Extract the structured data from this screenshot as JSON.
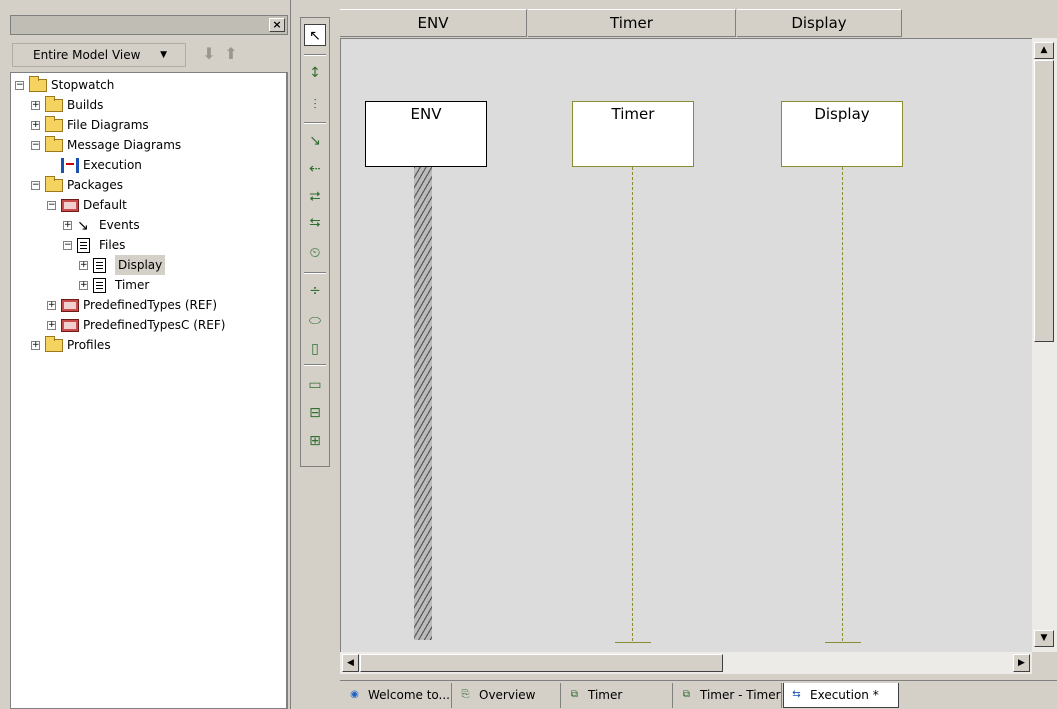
{
  "browser": {
    "view_label": "Entire Model View",
    "tree": [
      {
        "label": "Stopwatch",
        "icon": "project-folder-icon",
        "depth": 0,
        "expander": "−"
      },
      {
        "label": "Builds",
        "icon": "folder-icon",
        "depth": 1,
        "expander": "+"
      },
      {
        "label": "File Diagrams",
        "icon": "folder-icon",
        "depth": 1,
        "expander": "+"
      },
      {
        "label": "Message Diagrams",
        "icon": "folder-icon",
        "depth": 1,
        "expander": "−"
      },
      {
        "label": "Execution",
        "icon": "sequence-diagram-icon",
        "depth": 2,
        "expander": ""
      },
      {
        "label": "Packages",
        "icon": "folder-icon",
        "depth": 1,
        "expander": "−"
      },
      {
        "label": "Default",
        "icon": "package-icon",
        "depth": 2,
        "expander": "−"
      },
      {
        "label": "Events",
        "icon": "event-icon",
        "depth": 3,
        "expander": "+"
      },
      {
        "label": "Files",
        "icon": "files-icon",
        "depth": 3,
        "expander": "−"
      },
      {
        "label": "Display",
        "icon": "file-icon",
        "depth": 4,
        "expander": "+",
        "selected": true
      },
      {
        "label": "Timer",
        "icon": "file-icon",
        "depth": 4,
        "expander": "+"
      },
      {
        "label": "PredefinedTypes (REF)",
        "icon": "package-icon",
        "depth": 2,
        "expander": "+"
      },
      {
        "label": "PredefinedTypesC (REF)",
        "icon": "package-icon",
        "depth": 2,
        "expander": "+"
      },
      {
        "label": "Profiles",
        "icon": "folder-icon",
        "depth": 1,
        "expander": "+"
      }
    ]
  },
  "palette": {
    "tools": [
      "select-arrow-icon",
      "instance-line-icon",
      "env-line-icon",
      "message-icon",
      "reply-message-icon",
      "create-arrow-icon",
      "destroy-arrow-icon",
      "timeout-icon",
      "condition-mark-icon",
      "interaction-occurrence-icon",
      "action-block-icon",
      "partition-line-icon",
      "frame-icon",
      "frame-plus-icon"
    ]
  },
  "diagram": {
    "column_headers": [
      "ENV",
      "Timer",
      "Display"
    ],
    "lifelines": [
      {
        "name": "ENV",
        "kind": "environment"
      },
      {
        "name": "Timer",
        "kind": "instance"
      },
      {
        "name": "Display",
        "kind": "instance"
      }
    ],
    "colors": {
      "lifeline": "#8b8b32",
      "canvas": "#dcdcdc"
    }
  },
  "tabs": [
    {
      "label": "Welcome to...",
      "icon": "globe-icon",
      "active": false
    },
    {
      "label": "Overview",
      "icon": "file-diagram-icon",
      "active": false
    },
    {
      "label": "Timer",
      "icon": "statechart-icon",
      "active": false
    },
    {
      "label": "Timer - Timer",
      "icon": "statechart-icon",
      "active": false
    },
    {
      "label": "Execution *",
      "icon": "sequence-diagram-icon",
      "active": true
    }
  ]
}
